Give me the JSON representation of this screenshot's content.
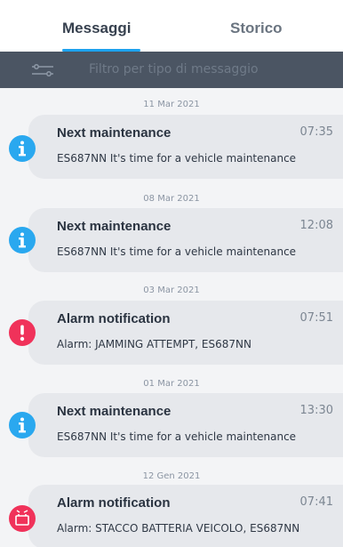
{
  "tabs": {
    "active": "Messaggi",
    "inactive": "Storico"
  },
  "filter": {
    "placeholder": "Filtro per tipo di messaggio",
    "icon": "filter-sliders-icon"
  },
  "colors": {
    "accent": "#1da3ef",
    "info": "#2aa8ef",
    "alarm": "#f0325a",
    "bar": "#4b5563"
  },
  "messages": [
    {
      "date": "11 Mar 2021",
      "title": "Next maintenance",
      "time": "07:35",
      "body": "ES687NN It's time for a vehicle maintenance",
      "icon": "info-icon"
    },
    {
      "date": "08 Mar 2021",
      "title": "Next maintenance",
      "time": "12:08",
      "body": "ES687NN It's time for a vehicle maintenance",
      "icon": "info-icon"
    },
    {
      "date": "03 Mar 2021",
      "title": "Alarm notification",
      "time": "07:51",
      "body": "Alarm: JAMMING ATTEMPT, ES687NN",
      "icon": "alert-icon"
    },
    {
      "date": "01 Mar 2021",
      "title": "Next maintenance",
      "time": "13:30",
      "body": "ES687NN It's time for a vehicle maintenance",
      "icon": "info-icon"
    },
    {
      "date": "12 Gen 2021",
      "title": "Alarm notification",
      "time": "07:41",
      "body": "Alarm: STACCO BATTERIA VEICOLO, ES687NN",
      "icon": "battery-icon"
    }
  ]
}
